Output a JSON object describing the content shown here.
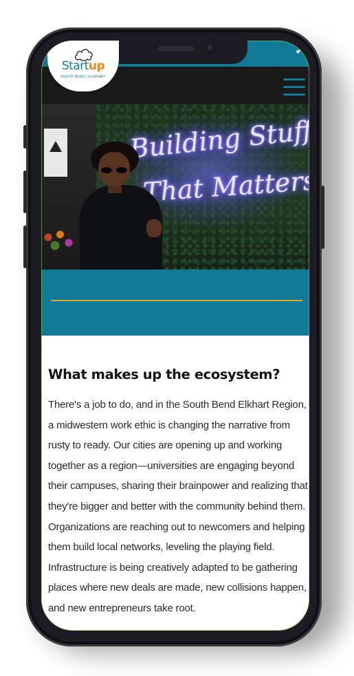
{
  "brand": {
    "logo_word_1": "Start",
    "logo_word_2": "up",
    "logo_subtitle": "SOUTH BEND | ELKHART"
  },
  "hero": {
    "neon_line_1": "Building Stuff",
    "neon_line_2": "That Matters"
  },
  "section": {
    "heading": "What makes up the ecosystem?",
    "body": "There's a job to do, and in the South Bend Elkhart Region, a midwestern work ethic is changing the narrative from rusty to ready. Our cities are opening up and working together as a region—universities are engaging beyond their campuses, sharing their brainpower and realizing that they're bigger and better with the community behind them. Organizations are reaching out to newcomers and helping them build local networks, leveling the playing field. Infrastructure is being creatively adapted to be gathering places where new deals are made, new collisions happen, and new entrepreneurs take root."
  },
  "icons": {
    "menu": "hamburger-icon",
    "logo_mark": "cloud-icon",
    "status": "chevron-icon"
  },
  "colors": {
    "brand_teal": "#117a97",
    "brand_orange": "#e38b1b",
    "divider_gold": "#e3a628",
    "nav_dark": "#1a1a1a",
    "device_frame": "#1d1c22"
  }
}
